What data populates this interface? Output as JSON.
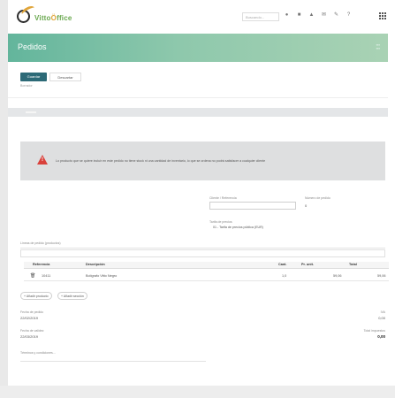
{
  "app": {
    "logo_text_prefix": "Vitto",
    "logo_text_accent": "Ö",
    "logo_text_suffix": "ffice"
  },
  "topbar": {
    "search_placeholder": "Buscando...",
    "icons": [
      "bell-icon",
      "chat-icon",
      "flag-icon",
      "mail-icon",
      "wrench-icon",
      "help-icon"
    ]
  },
  "header": {
    "title": "Pedidos"
  },
  "toolbar": {
    "save_label": "Guardar",
    "discard_label": "Descartar",
    "subcrumb": "Borrador"
  },
  "alert": {
    "text": "Lo producto que se quiere incluir en este pedido no tiene stock ni una cantidad de inventario, lo que se ordena no podrá satisfacer a cualquier cliente"
  },
  "form": {
    "customer_label": "Cliente / Referencia",
    "customer_value": "",
    "order_number_label": "Número de pedido",
    "order_number_value": "0",
    "pricelist_label": "Tarifa de precios",
    "pricelist_value": "01 - Tarifa de precios pública (EUR)",
    "lines_label": "Líneas de pedido (productos)"
  },
  "table": {
    "headers": [
      "Referencia",
      "Descripción",
      "Cant.",
      "Pr. unit.",
      "Total"
    ],
    "rows": [
      {
        "ref": "10411",
        "desc": "Bolígrafo Vitto Negro",
        "qty": "1,0",
        "unit": "59,06",
        "total": "59,06"
      }
    ]
  },
  "line_buttons": {
    "add_product": "Añadir producto",
    "add_section": "Añadir sección"
  },
  "footer": {
    "date_label": "Fecha de pedido",
    "date_value": "22/02/2019",
    "validity_label": "Fecha de validez",
    "validity_value": "22/03/2019",
    "terms_label": "Términos y condiciones...",
    "tax_label": "IVA",
    "tax_value": "0,00",
    "total_label": "Total impuestos",
    "total_value": "0,00"
  }
}
